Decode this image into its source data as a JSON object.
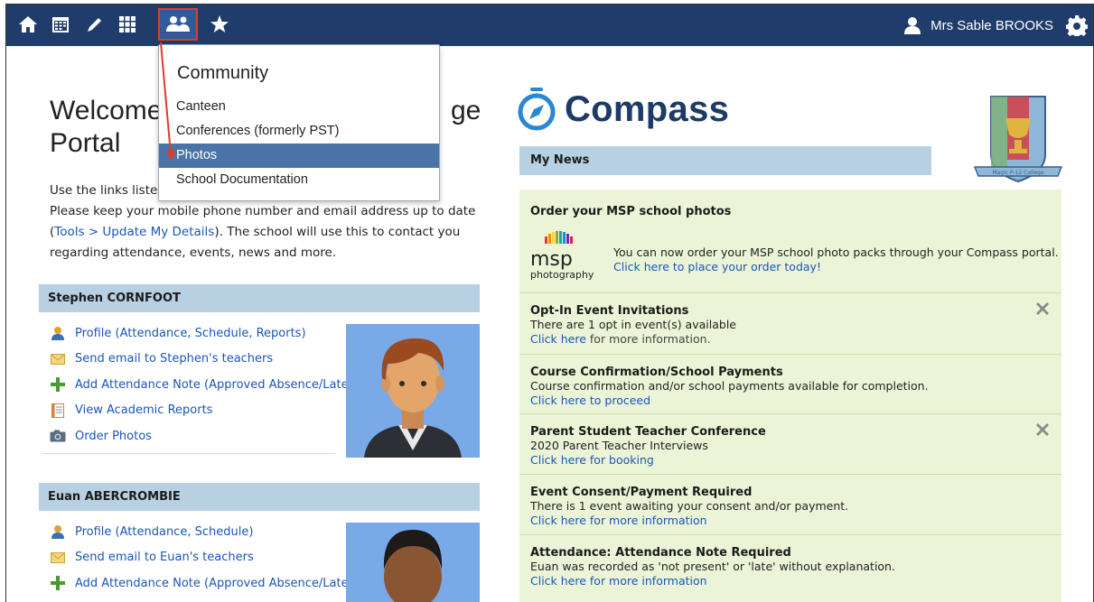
{
  "topbar": {
    "icons": [
      "home-icon",
      "calendar-icon",
      "pencil-icon",
      "apps-grid-icon",
      "community-icon",
      "star-icon"
    ],
    "user_name": "Mrs Sable BROOKS",
    "colors": {
      "bar": "#1f3c6b",
      "highlight": "#e03b2b"
    }
  },
  "dropdown": {
    "title": "Community",
    "items": [
      {
        "label": "Canteen"
      },
      {
        "label": "Conferences (formerly PST)"
      },
      {
        "label": "Photos"
      },
      {
        "label": "School Documentation"
      }
    ],
    "selected": "Photos"
  },
  "welcome": {
    "line1": "Welcome",
    "line1_tail": "ge",
    "line2": "Portal",
    "intro_line1": "Use the links listed",
    "intro_line2": "Please keep your mobile phone number and email address up to date",
    "intro_open": "(",
    "intro_link": "Tools > Update My Details",
    "intro_rest": "). The school will use this to contact you",
    "intro_line4": "regarding attendance, events, news and more."
  },
  "students": [
    {
      "name": "Stephen CORNFOOT",
      "links": [
        "Profile (Attendance, Schedule, Reports)",
        "Send email to Stephen's teachers",
        "Add Attendance Note (Approved Absence/Late)",
        "View Academic Reports",
        "Order Photos"
      ]
    },
    {
      "name": "Euan ABERCROMBIE",
      "links": [
        "Profile (Attendance, Schedule)",
        "Send email to Euan's teachers",
        "Add Attendance Note (Approved Absence/Late)"
      ]
    }
  ],
  "brand": {
    "name": "Compass",
    "crest_text": "Magic P-12 College",
    "msp_name": "msp",
    "msp_sub": "photography"
  },
  "news": {
    "header": "My News",
    "items": [
      {
        "title": "Order your MSP school photos",
        "body": "You can now order your MSP school photo packs through your Compass portal.",
        "link": "Click here to place your order today!"
      },
      {
        "title": "Opt-In Event Invitations",
        "body": "There are 1 opt in event(s) available",
        "link": "Click here",
        "link_rest": " for more information.",
        "closable": true
      },
      {
        "title": "Course Confirmation/School Payments",
        "body": "Course confirmation and/or school payments available for completion.",
        "link": "Click here to proceed"
      },
      {
        "title": "Parent Student Teacher Conference",
        "body": "2020 Parent Teacher Interviews",
        "link": "Click here for booking",
        "closable": true
      },
      {
        "title": "Event Consent/Payment Required",
        "body": "There is 1 event awaiting your consent and/or payment.",
        "link": "Click here for more information"
      },
      {
        "title": "Attendance: Attendance Note Required",
        "body": "Euan was recorded as 'not present' or 'late' without explanation.",
        "link": "Click here for more information"
      }
    ]
  }
}
